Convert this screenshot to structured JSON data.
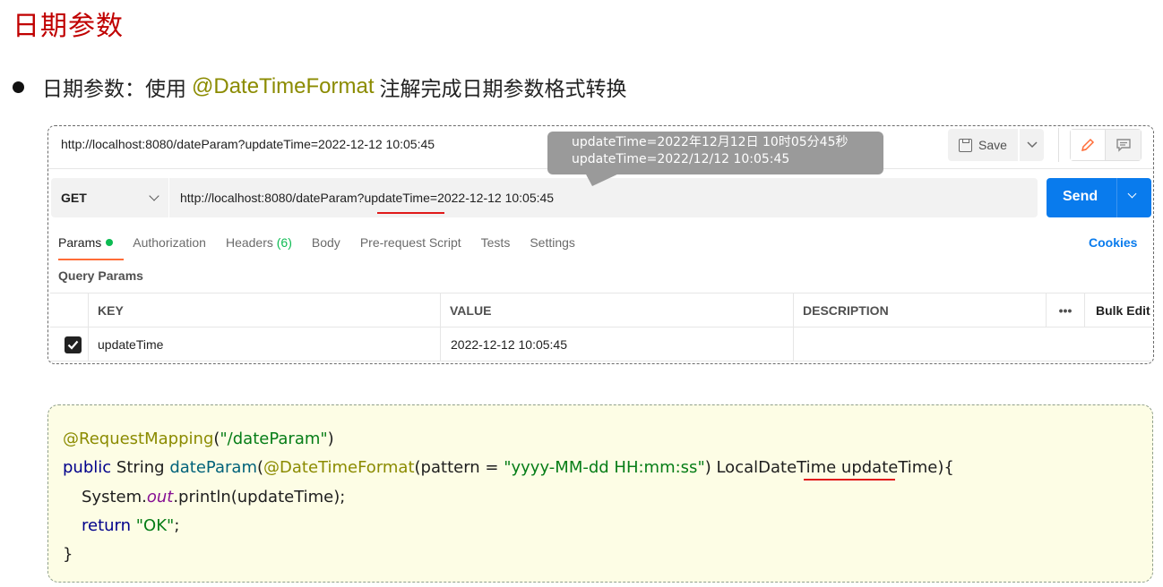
{
  "slide": {
    "title": "日期参数",
    "bullet_prefix": "日期参数：使用",
    "bullet_annotation": "@DateTimeFormat",
    "bullet_suffix": "注解完成日期参数格式转换"
  },
  "postman": {
    "tab_url": "http://localhost:8080/dateParam?updateTime=2022-12-12 10:05:45",
    "save_label": "Save",
    "tooltip_lines": [
      "updateTime=2022年12月12日 10时05分45秒",
      "updateTime=2022/12/12 10:05:45"
    ],
    "method": "GET",
    "url_prefix": "http://localhost:8080/dateParam?",
    "url_param": "updateTime",
    "url_suffix": "=2022-12-12 10:05:45",
    "send_label": "Send",
    "tabs": {
      "params": "Params",
      "authorization": "Authorization",
      "headers": "Headers",
      "headers_count": "(6)",
      "body": "Body",
      "prerequest": "Pre-request Script",
      "tests": "Tests",
      "settings": "Settings"
    },
    "cookies_label": "Cookies",
    "query_params_label": "Query Params",
    "table": {
      "headers": {
        "key": "KEY",
        "value": "VALUE",
        "description": "DESCRIPTION",
        "more": "•••",
        "bulk_edit": "Bulk Edit"
      },
      "row": {
        "key": "updateTime",
        "value": "2022-12-12 10:05:45",
        "description": ""
      }
    }
  },
  "code": {
    "line1_annot": "@RequestMapping",
    "line1_open": "(",
    "line1_str": "\"/dateParam\"",
    "line1_close": ")",
    "line2_kw": "public",
    "line2_type": " String ",
    "line2_method": "dateParam",
    "line2_open": "(",
    "line2_annot": "@DateTimeFormat",
    "line2_mid": "(pattern = ",
    "line2_str": "\"yyyy-MM-dd HH:mm:ss\"",
    "line2_rest": ") LocalDateTime updateTime){",
    "line3_a": "System.",
    "line3_italic": "out",
    "line3_b": ".println(updateTime);",
    "line4_kw": "return",
    "line4_sp": " ",
    "line4_str": "\"OK\"",
    "line4_end": ";",
    "line5": "}"
  }
}
